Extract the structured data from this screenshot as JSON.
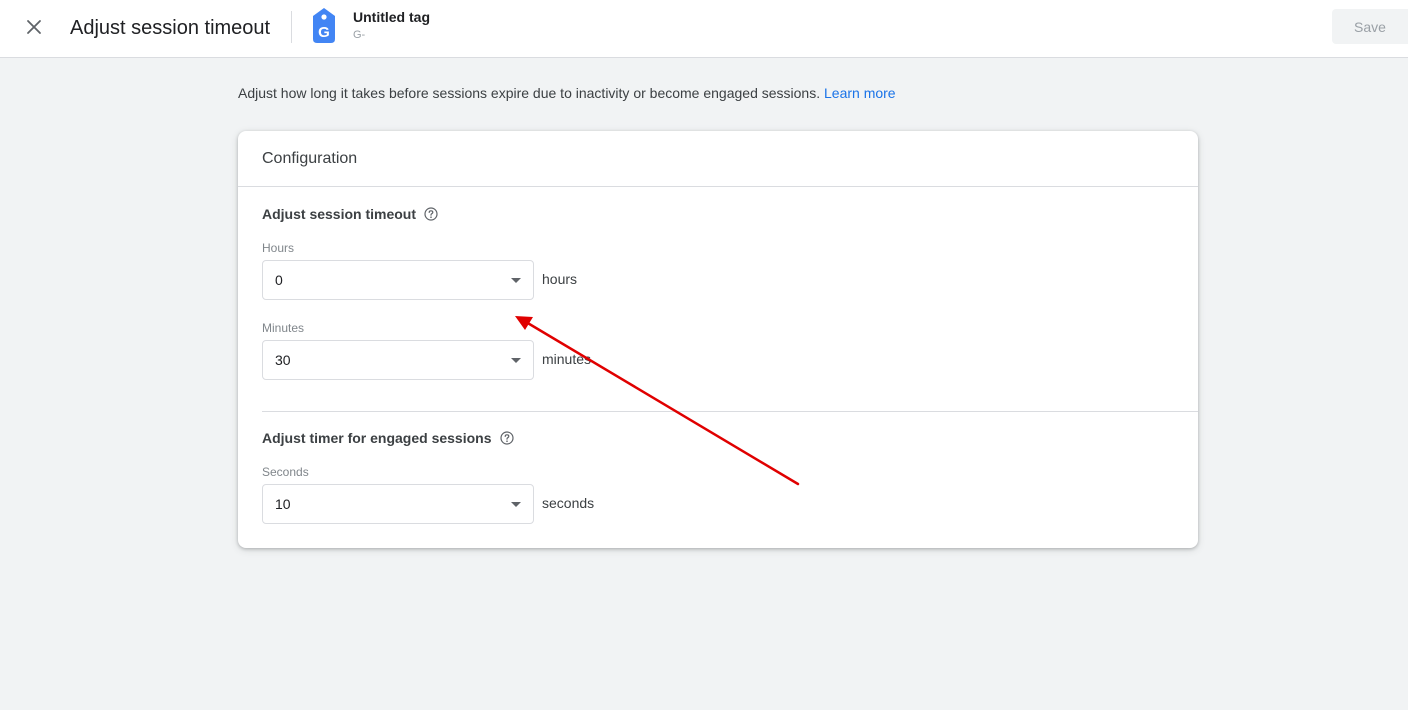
{
  "header": {
    "title": "Adjust session timeout",
    "tag_name": "Untitled tag",
    "tag_id": "G-",
    "save_label": "Save",
    "icons": {
      "close": "close-icon",
      "tag": "google-tag-icon"
    },
    "tag_color": "#4285f4"
  },
  "intro": {
    "text": "Adjust how long it takes before sessions expire due to inactivity or become engaged sessions.",
    "link": "Learn more",
    "link_color": "#1a73e8"
  },
  "configuration": {
    "title": "Configuration",
    "session_timeout": {
      "title": "Adjust session timeout",
      "hours": {
        "label": "Hours",
        "value": "0",
        "unit": "hours"
      },
      "minutes": {
        "label": "Minutes",
        "value": "30",
        "unit": "minutes"
      }
    },
    "engaged": {
      "title": "Adjust timer for engaged sessions",
      "seconds": {
        "label": "Seconds",
        "value": "10",
        "unit": "seconds"
      }
    }
  },
  "annotation": {
    "type": "arrow",
    "color": "#e00000",
    "points_to": "hours-select"
  }
}
